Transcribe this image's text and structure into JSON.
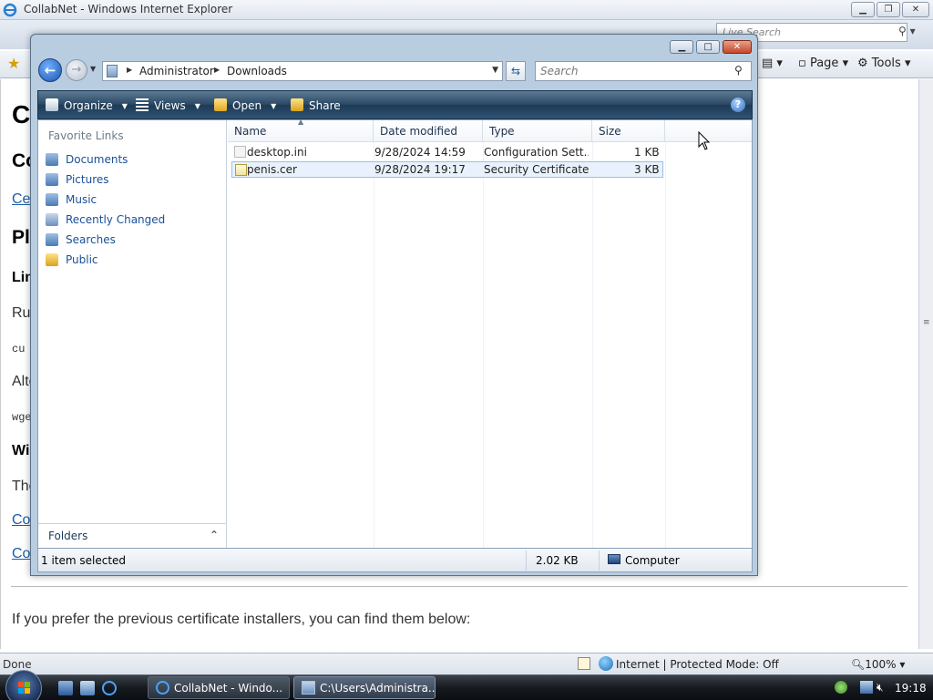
{
  "ie": {
    "title": "CollabNet - Windows Internet Explorer",
    "search_placeholder": "Live Search",
    "commands": {
      "page": "Page",
      "tools": "Tools"
    },
    "status": "Done",
    "zone": "Internet | Protected Mode: Off",
    "zoom": "100%",
    "page": {
      "heading1": "C",
      "heading2": "Co",
      "link1": "Ce",
      "heading3": "Pl",
      "heading4": "Lin",
      "text1": "Ru",
      "code1": "cu",
      "text2": "Alte",
      "code2": "wge",
      "heading5": "Wi",
      "text3": "The",
      "link2": "Co",
      "link3": "Co",
      "bottom_text": "If you prefer the previous certificate installers, you can find them below:"
    }
  },
  "explorer": {
    "breadcrumb": [
      "Administrator",
      "Downloads"
    ],
    "search_placeholder": "Search",
    "toolbar": {
      "organize": "Organize",
      "views": "Views",
      "open": "Open",
      "share": "Share",
      "help": "?"
    },
    "favorite_links_title": "Favorite Links",
    "favorite_links": [
      {
        "label": "Documents",
        "icon": "documents-icon"
      },
      {
        "label": "Pictures",
        "icon": "pictures-icon"
      },
      {
        "label": "Music",
        "icon": "music-icon"
      },
      {
        "label": "Recently Changed",
        "icon": "recently-changed-icon"
      },
      {
        "label": "Searches",
        "icon": "searches-icon"
      },
      {
        "label": "Public",
        "icon": "public-folder-icon"
      }
    ],
    "folders_label": "Folders",
    "columns": [
      "Name",
      "Date modified",
      "Type",
      "Size"
    ],
    "files": [
      {
        "name": "desktop.ini",
        "date": "9/28/2024 14:59",
        "type": "Configuration Sett...",
        "size": "1 KB",
        "icon": "config-file-icon",
        "selected": false
      },
      {
        "name": "penis.cer",
        "date": "9/28/2024 19:17",
        "type": "Security Certificate",
        "size": "3 KB",
        "icon": "certificate-icon",
        "selected": true
      }
    ],
    "status": {
      "selection": "1 item selected",
      "size": "2.02 KB",
      "location": "Computer"
    }
  },
  "taskbar": {
    "tasks": [
      {
        "label": "CollabNet - Windo...",
        "icon": "ie-icon"
      },
      {
        "label": "C:\\Users\\Administra...",
        "icon": "folder-icon"
      }
    ],
    "clock": "19:18"
  }
}
